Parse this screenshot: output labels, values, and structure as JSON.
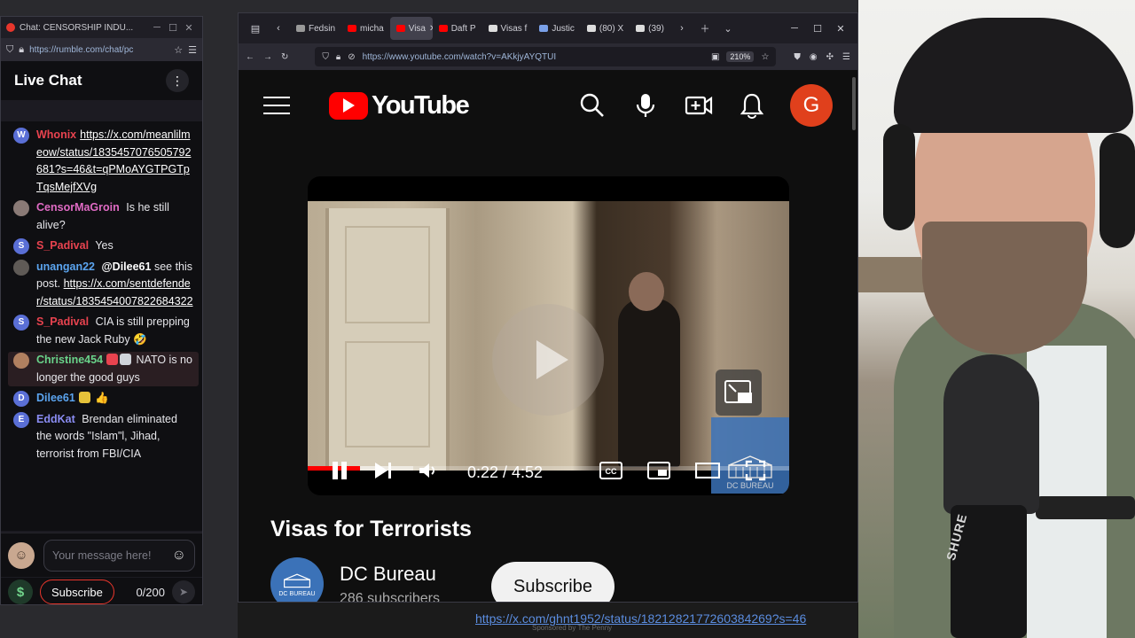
{
  "chat_window": {
    "tab_title": "Chat: CENSORSHIP INDU...",
    "url": "https://rumble.com/chat/pc",
    "header_title": "Live Chat",
    "messages": [
      {
        "user": "Whonix",
        "initial": "W",
        "color": "#e8434f",
        "avatar_bg": "#5a6fd6",
        "text": "",
        "link": "https://x.com/meanlilmeow/status/1835457076505792681?s=46&t=qPMoAYGTPGTpTqsMejfXVg"
      },
      {
        "user": "CensorMaGroin",
        "initial": "",
        "color": "#e06bc4",
        "avatar_bg": "#8a7a76",
        "text": "Is he still alive?",
        "link": ""
      },
      {
        "user": "S_Padival",
        "initial": "S",
        "color": "#e8434f",
        "avatar_bg": "#5a6fd6",
        "text": "Yes",
        "link": ""
      },
      {
        "user": "unangan22",
        "initial": "",
        "color": "#5ba4ef",
        "avatar_bg": "#5f5a56",
        "mention": "@Dilee61",
        "text": "see this post.",
        "link": "https://x.com/sentdefender/status/1835454007822684322"
      },
      {
        "user": "S_Padival",
        "initial": "S",
        "color": "#e8434f",
        "avatar_bg": "#5a6fd6",
        "text": "CIA is still prepping the new Jack Ruby",
        "emoji": "🤣",
        "link": ""
      },
      {
        "user": "Christine454",
        "initial": "",
        "color": "#69d38a",
        "avatar_bg": "#b08060",
        "text": "NATO is no longer the good guys",
        "link": "",
        "highlight": true
      },
      {
        "user": "Dilee61",
        "initial": "D",
        "color": "#5ba4ef",
        "avatar_bg": "#5a6fd6",
        "text": "",
        "emoji": "👍",
        "link": ""
      },
      {
        "user": "EddKat",
        "initial": "E",
        "color": "#8a8cf2",
        "avatar_bg": "#5a6fd6",
        "text": "Brendan eliminated the words \"Islam\"l, Jihad, terrorist from FBI/CIA",
        "link": ""
      }
    ],
    "input_placeholder": "Your message here!",
    "subscribe_label": "Subscribe",
    "char_count": "0/200"
  },
  "browser": {
    "tabs": [
      {
        "label": "Fedsin",
        "color": "#999999"
      },
      {
        "label": "micha",
        "color": "#ff0000"
      },
      {
        "label": "Visa",
        "color": "#ff0000",
        "active": true
      },
      {
        "label": "Daft P",
        "color": "#ff0000"
      },
      {
        "label": "Visas f",
        "color": "#dddddd"
      },
      {
        "label": "Justic",
        "color": "#7aa0e8"
      },
      {
        "label": "(80) X",
        "color": "#dddddd"
      },
      {
        "label": "(39)",
        "color": "#dddddd"
      }
    ],
    "url": "https://www.youtube.com/watch?v=AKkjyAYQTUI",
    "zoom": "210%"
  },
  "youtube": {
    "logo_text": "YouTube",
    "avatar_initial": "G",
    "player": {
      "time": "0:22 / 4:52",
      "progress_played": 0.108,
      "progress_buffered": 0.22,
      "overlay_caption": "DC BUREAU"
    },
    "video_title": "Visas for Terrorists",
    "channel": {
      "name": "DC Bureau",
      "subscribers": "286 subscribers",
      "avatar_caption": "DC BUREAU",
      "subscribe_label": "Subscribe"
    }
  },
  "background_page": {
    "link": "https://x.com/ghnt1952/status/1821282177260384269?s=46",
    "sponsor": "Sponsored by The Penny"
  },
  "webcam": {
    "mic_brand": "SHURE"
  }
}
